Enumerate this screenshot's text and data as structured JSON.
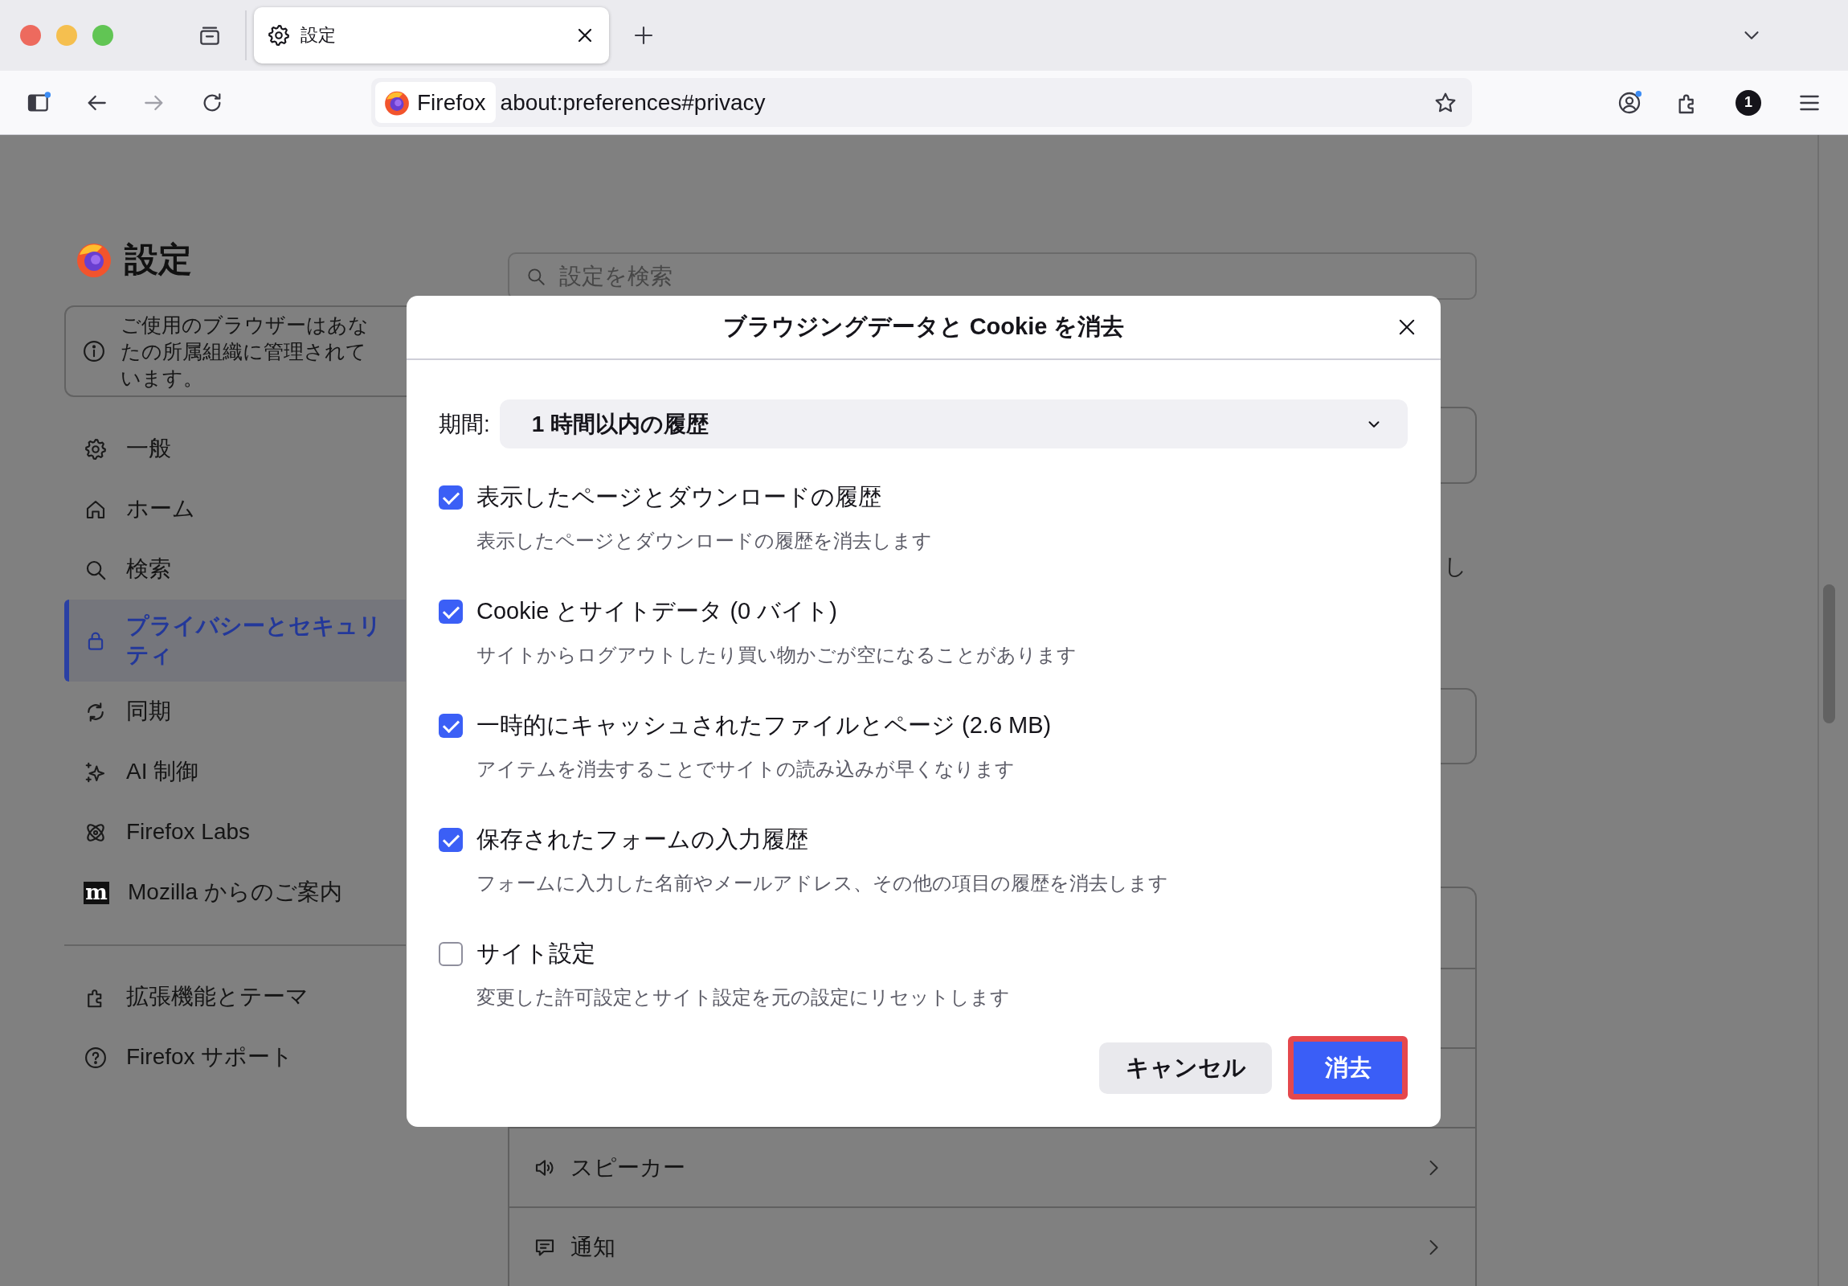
{
  "tabs": [
    {
      "label": "設定",
      "selected": true
    }
  ],
  "toolbar": {
    "identity_label": "Firefox",
    "url": "about:preferences#privacy",
    "extension_badge": "1"
  },
  "sidebar": {
    "title": "設定",
    "notice": "ご使用のブラウザーはあなたの所属組織に管理されています。",
    "items": [
      {
        "label": "一般",
        "selected": false
      },
      {
        "label": "ホーム",
        "selected": false
      },
      {
        "label": "検索",
        "selected": false
      },
      {
        "label": "プライバシーとセキュリティ",
        "selected": true
      },
      {
        "label": "同期",
        "selected": false
      },
      {
        "label": "AI 制御",
        "selected": false
      },
      {
        "label": "Firefox Labs",
        "selected": false
      },
      {
        "icon_glyph": "m",
        "label": "Mozilla からのご案内",
        "selected": false
      }
    ],
    "footer_items": [
      {
        "label": "拡張機能とテーマ"
      },
      {
        "label": "Firefox サポート"
      }
    ]
  },
  "search": {
    "placeholder": "設定を検索"
  },
  "background_text": "し",
  "background_rows": [
    {
      "label": "スピーカー"
    },
    {
      "label": "通知"
    }
  ],
  "dialog": {
    "title": "ブラウジングデータと Cookie を消去",
    "period_label": "期間:",
    "period_value": "1 時間以内の履歴",
    "options": [
      {
        "label": "表示したページとダウンロードの履歴",
        "description": "表示したページとダウンロードの履歴を消去します",
        "checked": true
      },
      {
        "label": "Cookie とサイトデータ (0 バイト)",
        "description": "サイトからログアウトしたり買い物かごが空になることがあります",
        "checked": true
      },
      {
        "label": "一時的にキャッシュされたファイルとページ (2.6 MB)",
        "description": "アイテムを消去することでサイトの読み込みが早くなります",
        "checked": true
      },
      {
        "label": "保存されたフォームの入力履歴",
        "description": "フォームに入力した名前やメールアドレス、その他の項目の履歴を消去します",
        "checked": true
      },
      {
        "label": "サイト設定",
        "description": "変更した許可設定とサイト設定を元の設定にリセットします",
        "checked": false
      }
    ],
    "buttons": [
      {
        "label": "キャンセル",
        "kind": "secondary",
        "focused": false
      },
      {
        "label": "消去",
        "kind": "primary",
        "focused": true
      }
    ]
  }
}
